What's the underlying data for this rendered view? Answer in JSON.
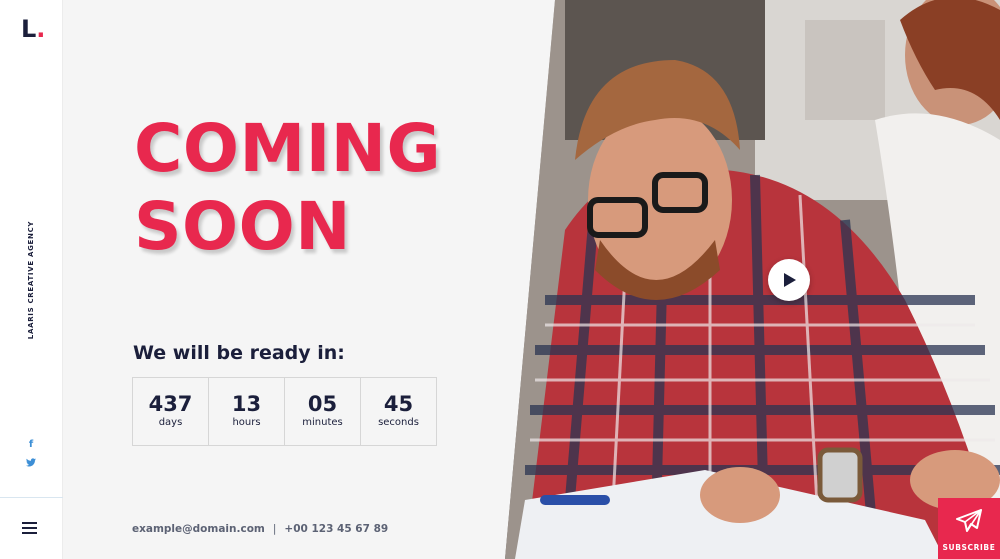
{
  "sidebar": {
    "logo_letter": "L",
    "logo_dot": ".",
    "agency_name": "LAARIS CREATIVE AGENCY",
    "social": {
      "facebook": "f",
      "facebook_icon": "facebook-icon",
      "twitter_icon": "twitter-icon"
    },
    "menu_icon": "hamburger-menu-icon"
  },
  "hero": {
    "line1": "COMING",
    "line2": "SOON"
  },
  "countdown": {
    "heading": "We will be ready in:",
    "items": [
      {
        "value": "437",
        "label": "days"
      },
      {
        "value": "13",
        "label": "hours"
      },
      {
        "value": "05",
        "label": "minutes"
      },
      {
        "value": "45",
        "label": "seconds"
      }
    ]
  },
  "contact": {
    "email": "example@domain.com",
    "separator": "|",
    "phone": "+00 123 45 67 89"
  },
  "media": {
    "play_icon": "play-icon"
  },
  "subscribe": {
    "label": "SUBSCRIBE",
    "icon": "paper-plane-icon"
  },
  "colors": {
    "accent": "#e8284e",
    "navy": "#1b1f3b",
    "background": "#f5f5f5",
    "social": "#3d8fd6"
  }
}
